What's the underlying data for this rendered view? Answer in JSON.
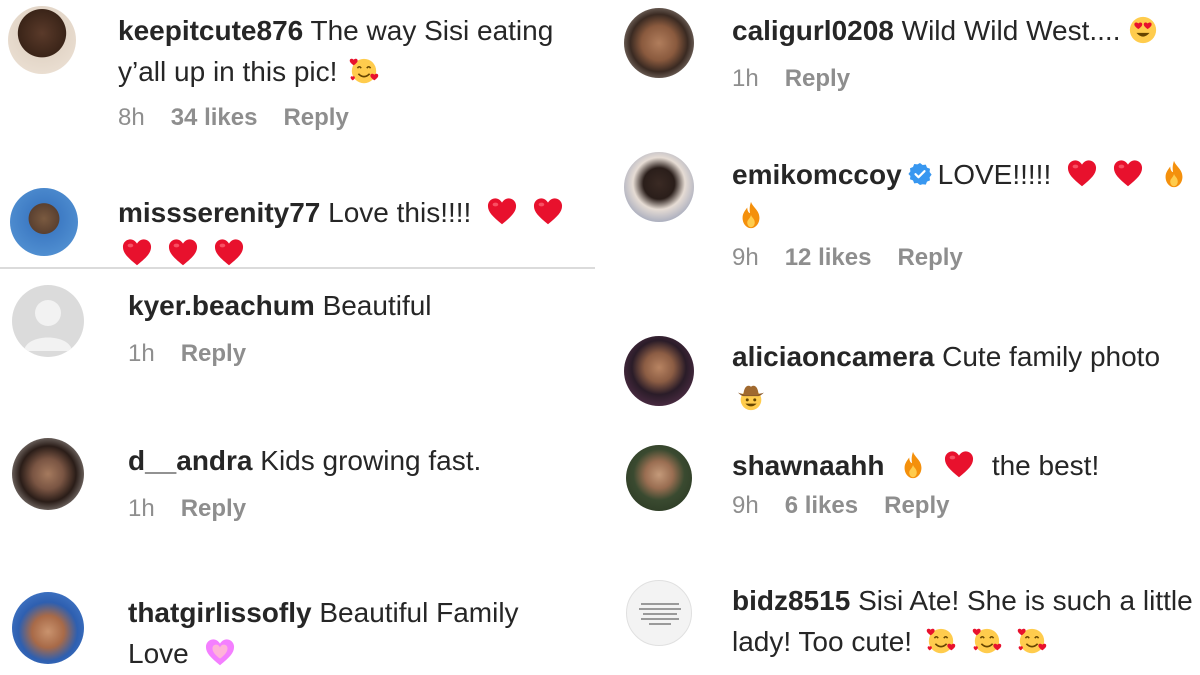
{
  "left_comments": [
    {
      "user": "keepitcute876",
      "text": "The way Sisi eating",
      "text2": "y’all up in this pic!",
      "meta_time": "8h",
      "meta_likes": "34 likes",
      "meta_reply": "Reply"
    },
    {
      "user": "missserenity77",
      "text": "Love this!!!!",
      "meta_time": "",
      "meta_likes": "",
      "meta_reply": ""
    },
    {
      "user": "kyer.beachum",
      "text": "Beautiful",
      "meta_time": "1h",
      "meta_likes": "",
      "meta_reply": "Reply"
    },
    {
      "user": "d__andra",
      "text": "Kids growing fast.",
      "meta_time": "1h",
      "meta_likes": "",
      "meta_reply": "Reply"
    },
    {
      "user": "thatgirlissofly",
      "text": "Beautiful Family",
      "text2": "Love",
      "meta_time": "",
      "meta_likes": "",
      "meta_reply": ""
    }
  ],
  "right_comments": [
    {
      "user": "caligurl0208",
      "text": "Wild Wild West....",
      "meta_time": "1h",
      "meta_likes": "",
      "meta_reply": "Reply"
    },
    {
      "user": "emikomccoy",
      "text": "LOVE!!!!!",
      "meta_time": "9h",
      "meta_likes": "12 likes",
      "meta_reply": "Reply"
    },
    {
      "user": "aliciaoncamera",
      "text": "Cute family photo",
      "meta_time": "",
      "meta_likes": "",
      "meta_reply": ""
    },
    {
      "user": "shawnaahh",
      "text": "the best!",
      "meta_time": "9h",
      "meta_likes": "6 likes",
      "meta_reply": "Reply"
    },
    {
      "user": "bidz8515",
      "text": "Sisi Ate! She is such a little",
      "text2": "lady! Too cute!",
      "meta_time": "",
      "meta_likes": "",
      "meta_reply": ""
    }
  ],
  "icons": {
    "heart": "red-heart-icon",
    "fire": "fire-icon",
    "smiling-hearts": "smiling-face-with-hearts-icon",
    "heart-eyes": "smiling-face-heart-eyes-icon",
    "pink-heart": "sparkling-heart-icon",
    "cowboy": "cowboy-face-icon",
    "verified": "verified-badge-icon"
  },
  "colors": {
    "text": "#262626",
    "meta": "#8e8e8e",
    "heart": "#e8112d",
    "verified": "#3897f0",
    "divider": "#dbdbdb"
  }
}
